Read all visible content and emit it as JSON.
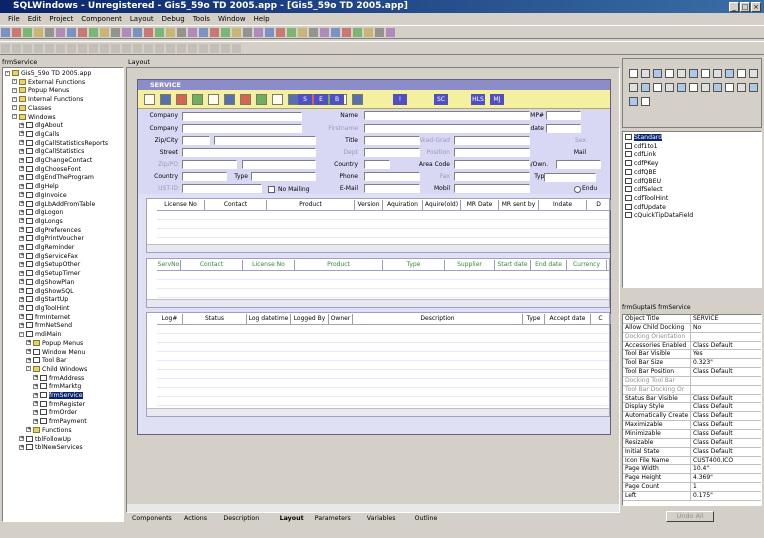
{
  "title": "SQLWindows - Unregistered - Gis5_59o TD 2005.app - [Gis5_59o TD 2005.app]",
  "menu": [
    "File",
    "Edit",
    "Project",
    "Component",
    "Layout",
    "Debug",
    "Tools",
    "Window",
    "Help"
  ],
  "left_panel": {
    "title": "frmService",
    "tree": [
      "Gis5_59o TD 2005.app",
      "External Functions",
      "Popup Menus",
      "Internal Functions",
      "Classes",
      "Windows",
      "dlgAbout",
      "dlgCalls",
      "dlgCallStatisticsReports",
      "dlgCallStatistics",
      "dlgChangeContact",
      "dlgChooseFont",
      "dlgEndTheProgram",
      "dlgHelp",
      "dlgInvoice",
      "dlgLbAddFromTable",
      "dlgLogon",
      "dlgLongs",
      "dlgPreferences",
      "dlgPrintVoucher",
      "dlgReminder",
      "dlgServiceFax",
      "dlgSetupOther",
      "dlgSetupTimer",
      "dlgShowPlan",
      "dlgShowSQL",
      "dlgStartUp",
      "dlgToolHint",
      "frmInternet",
      "frmNetSend",
      "mdiMain",
      "Popup Menus",
      "Window Menu",
      "Tool Bar",
      "Child Windows",
      "frmAddress",
      "frmMarktg",
      "frmService",
      "frmRegister",
      "frmOrder",
      "frmPayment",
      "Functions",
      "tblFollowUp",
      "tblNewServices"
    ]
  },
  "layout_label": "Layout",
  "form": {
    "title": "SERVICE",
    "toolbar": [
      "S",
      "E",
      "B",
      "!",
      "SC",
      "HLS",
      "MJ"
    ],
    "labels": {
      "company": "Company",
      "company2": "Company",
      "zip": "Zip/City",
      "street": "Street",
      "zippo": "Zip/PO",
      "country": "Country",
      "type": "Type",
      "ust": "UST-ID",
      "nomail": "No Mailing",
      "name": "Name",
      "firstname": "Firstname",
      "title": "Title",
      "akad": "Akad-Grad",
      "dept": "Dept",
      "position": "Position",
      "country2": "Country",
      "areacode": "Area Code",
      "phone": "Phone",
      "fax": "Fax",
      "email": "E-Mail",
      "mobil": "Mobil",
      "comp": "COMP#",
      "indate": "Indate",
      "sex": "Sex",
      "mail": "Mail",
      "auth": "Auth/Own.",
      "type2": "Type",
      "endu": "Endu"
    },
    "grid1": [
      "License No",
      "Contact",
      "Product",
      "Version",
      "Aquiration",
      "Aquire(old)",
      "MR Date",
      "MR sent by",
      "Indate",
      "D"
    ],
    "grid2": [
      "ServNo",
      "Contact",
      "License No",
      "Product",
      "Type",
      "Supplier",
      "Start date",
      "End date",
      "Currency"
    ],
    "grid3": [
      "Log#",
      "Status",
      "Log datetime",
      "Logged By",
      "Owner",
      "Description",
      "Type",
      "Accept date",
      "C"
    ]
  },
  "bottom_tabs": [
    "Components",
    "Actions",
    "Description",
    "Layout",
    "Parameters",
    "Variables",
    "Outline"
  ],
  "controls": [
    "Standard",
    "cdf1to1",
    "cdfLink",
    "cdfPKey",
    "cdfQBE",
    "cdfQBEU",
    "cdfSelect",
    "cdfToolHint",
    "cdfUpdate",
    "cQuickTipDataField"
  ],
  "props_title": "frmGuptaIS frmService",
  "props": [
    [
      "Object Title",
      "SERVICE"
    ],
    [
      "Allow Child Docking",
      "No"
    ],
    [
      "Docking Orientation",
      ""
    ],
    [
      "Accessories Enabled",
      "Class Default"
    ],
    [
      "Tool Bar Visible",
      "Yes"
    ],
    [
      "Tool Bar Size",
      "0.323\""
    ],
    [
      "Tool Bar Position",
      "Class Default"
    ],
    [
      "Docking Tool Bar",
      ""
    ],
    [
      "Tool Bar Docking Or",
      ""
    ],
    [
      "Status Bar Visible",
      "Class Default"
    ],
    [
      "Display Style",
      "Class Default"
    ],
    [
      "Automatically Create",
      "Class Default"
    ],
    [
      "Maximizable",
      "Class Default"
    ],
    [
      "Minimizable",
      "Class Default"
    ],
    [
      "Resizable",
      "Class Default"
    ],
    [
      "Initial State",
      "Class Default"
    ],
    [
      "Icon File Name",
      "CUST400.ICO"
    ],
    [
      "Page Width",
      "10.4\""
    ],
    [
      "Page Height",
      "4.369\""
    ],
    [
      "Page Count",
      "1"
    ],
    [
      "Left",
      "0.175\""
    ]
  ],
  "undo_all": "Undo All"
}
